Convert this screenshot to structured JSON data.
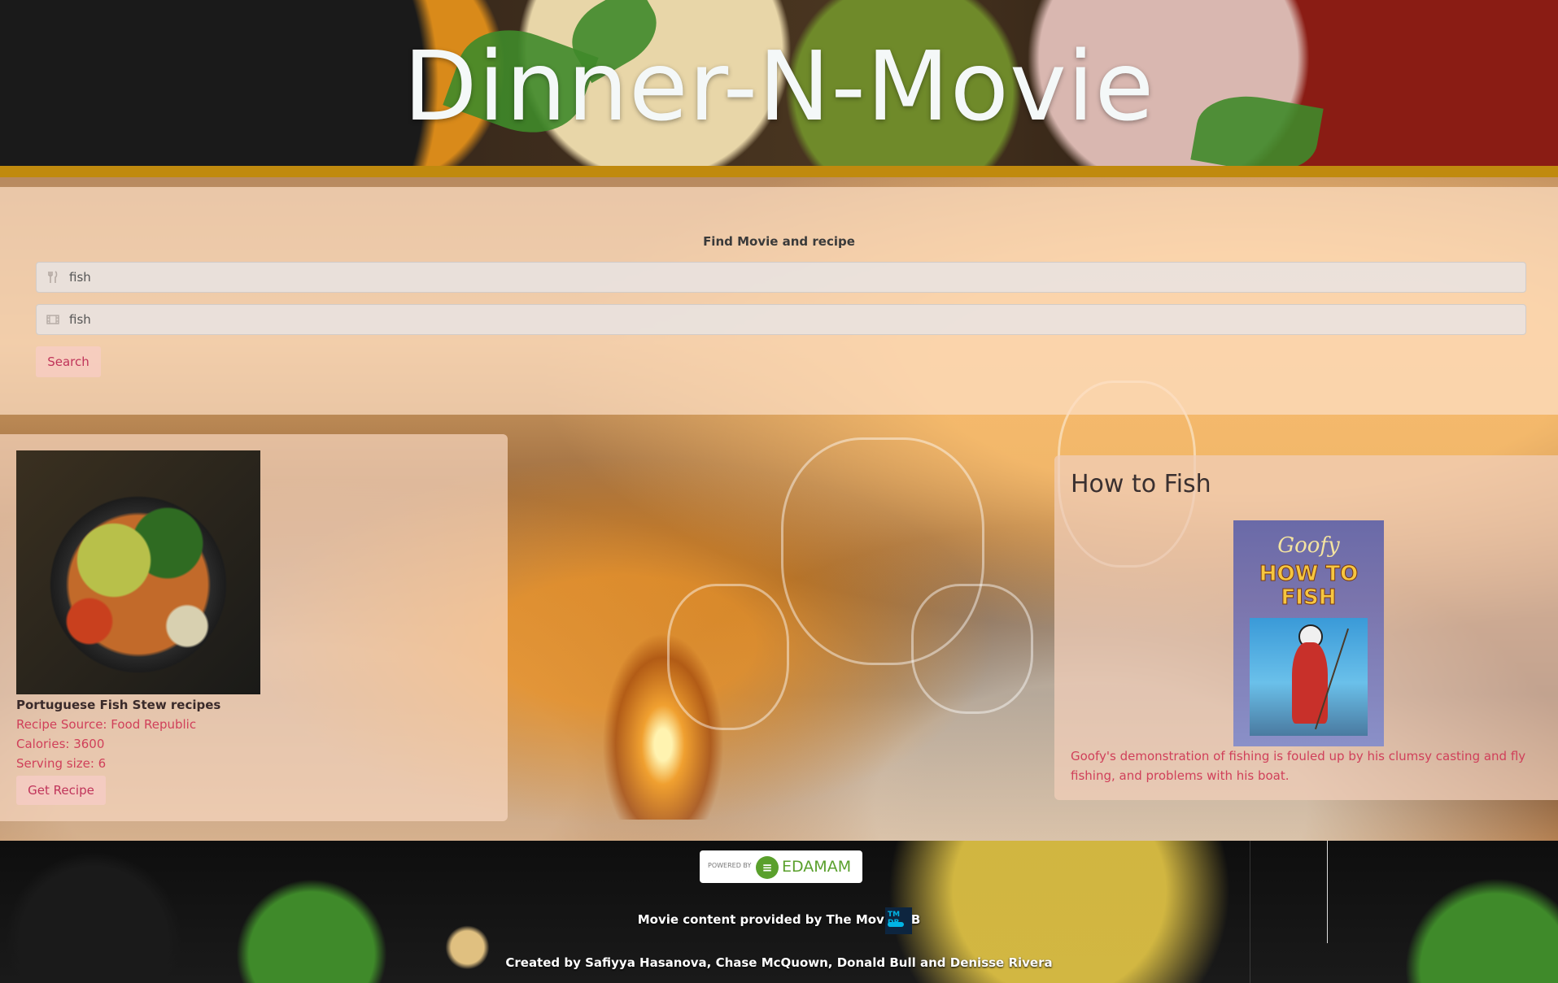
{
  "header": {
    "title": "Dinner-N-Movie"
  },
  "search": {
    "heading": "Find Movie and recipe",
    "recipe_query": "fish",
    "movie_query": "fish",
    "recipe_icon": "utensils-icon",
    "movie_icon": "film-icon",
    "button_label": "Search"
  },
  "recipe": {
    "title": "Portuguese Fish Stew recipes",
    "source": "Recipe Source: Food Republic",
    "calories": "Calories: 3600",
    "serving": "Serving size: 6",
    "button_label": "Get Recipe"
  },
  "movie": {
    "title": "How to Fish",
    "poster_line1": "Goofy",
    "poster_line2": "HOW TO FISH",
    "description": "Goofy's demonstration of fishing is fouled up by his clumsy casting and fly fishing, and problems with his boat."
  },
  "footer": {
    "powered_by": "POWERED BY",
    "edamam": "EDAMAM",
    "movie_credit": "Movie content provided by The Movie DB",
    "tmdb_badge": "TM DB",
    "created_by": "Created by  Safiyya Hasanova, Chase McQuown, Donald Bull  and  Denisse Rivera"
  },
  "colors": {
    "accent_band": "#c08a0e",
    "link_pink": "#d0405a",
    "edamam_green": "#5aa02c"
  }
}
